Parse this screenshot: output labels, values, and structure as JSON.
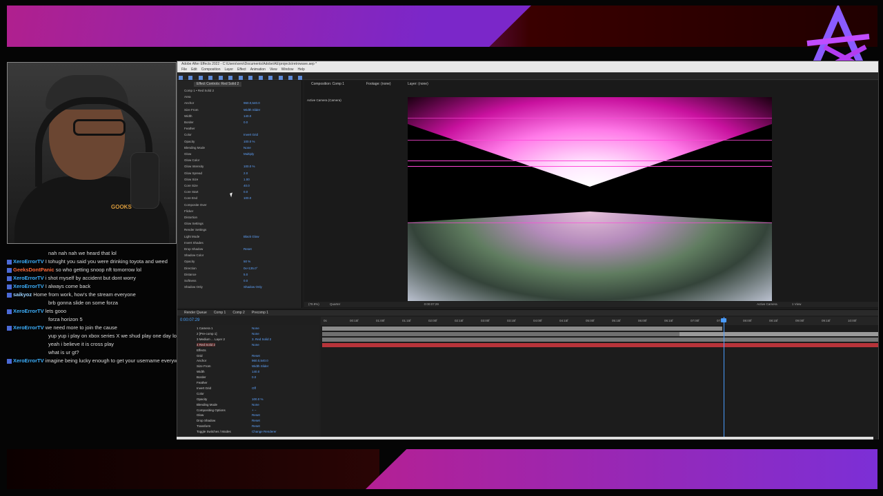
{
  "app": {
    "title": "Adobe After Effects 2022 - C:\\Users\\xero\\Documents\\Adobe\\AE\\projects\\retrowave.aep *",
    "menu": [
      "File",
      "Edit",
      "Composition",
      "Layer",
      "Effect",
      "Animation",
      "View",
      "Window",
      "Help"
    ]
  },
  "effects_panel": {
    "tab": "Effect Controls: Red Solid 2",
    "rows": [
      {
        "label": "Comp 1 • Red Solid 2",
        "value": ""
      },
      {
        "label": "Area",
        "value": ""
      },
      {
        "label": "Anchor",
        "value": "960.0,540.0"
      },
      {
        "label": "Size From",
        "value": "Width Slider"
      },
      {
        "label": "Width",
        "value": "140.0"
      },
      {
        "label": "Border",
        "value": "0.0"
      },
      {
        "label": "Feather",
        "value": ""
      },
      {
        "label": "Color",
        "value": "Invert Grid"
      },
      {
        "label": "Opacity",
        "value": "100.0 %"
      },
      {
        "label": "Blending Mode",
        "value": "None"
      },
      {
        "label": "Glow",
        "value": "Multiply"
      },
      {
        "label": "Glow Color",
        "value": ""
      },
      {
        "label": "Glow Intensity",
        "value": "100.0 %"
      },
      {
        "label": "Glow Spread",
        "value": "2.0"
      },
      {
        "label": "Glow Size",
        "value": "1.00"
      },
      {
        "label": "Core Size",
        "value": "40.0"
      },
      {
        "label": "Core Start",
        "value": "0.0"
      },
      {
        "label": "Core End",
        "value": "100.0"
      },
      {
        "label": "Composite Over",
        "value": ""
      },
      {
        "label": "Flicker",
        "value": ""
      },
      {
        "label": "Distortion",
        "value": ""
      },
      {
        "label": "Glow Settings",
        "value": ""
      },
      {
        "label": "Render Settings",
        "value": ""
      },
      {
        "label": "Light Mode",
        "value": "Black Glow"
      },
      {
        "label": "Invert Shades",
        "value": ""
      },
      {
        "label": "Drop Shadow",
        "value": "Reset"
      },
      {
        "label": "Shadow Color",
        "value": ""
      },
      {
        "label": "Opacity",
        "value": "50 %"
      },
      {
        "label": "Direction",
        "value": "0x+135.0°"
      },
      {
        "label": "Distance",
        "value": "5.0"
      },
      {
        "label": "Softness",
        "value": "0.0"
      },
      {
        "label": "Shadow Only",
        "value": "Shadow Only"
      }
    ]
  },
  "comp_panel": {
    "tabs": [
      "Composition: Comp 1",
      "Footage: (none)",
      "Layer: (none)"
    ],
    "active_camera": "Active Camera (Camera)",
    "footer": [
      "(78.9%)",
      "Quarter",
      "0:00:07:29",
      "Active Camera",
      "1 View"
    ]
  },
  "timeline": {
    "tabs": [
      "Render Queue",
      "Comp 1",
      "Comp 2",
      "Precomp 1"
    ],
    "timecode": "0:00:07:29",
    "ruler": [
      "0s",
      "00:15f",
      "01:00f",
      "01:15f",
      "02:00f",
      "02:15f",
      "03:00f",
      "03:15f",
      "04:00f",
      "04:15f",
      "05:00f",
      "05:15f",
      "06:00f",
      "06:15f",
      "07:00f",
      "07:15f",
      "08:00f",
      "08:15f",
      "09:00f",
      "09:15f",
      "10:00f"
    ],
    "layers": [
      {
        "label": "1  Camera 1",
        "value": "None"
      },
      {
        "label": "2  [Pre-comp 1]",
        "value": "None"
      },
      {
        "label": "3  Medium ... Layer 2",
        "value": "3. Red Solid 2"
      },
      {
        "label": "4  Red Solid 2",
        "value": "None"
      },
      {
        "label": "Effects",
        "value": ""
      },
      {
        "label": "Grid",
        "value": "Reset"
      },
      {
        "label": "Anchor",
        "value": "960.0,540.0"
      },
      {
        "label": "Size From",
        "value": "Width Slider"
      },
      {
        "label": "Width",
        "value": "140.0"
      },
      {
        "label": "Border",
        "value": "0.0"
      },
      {
        "label": "Feather",
        "value": ""
      },
      {
        "label": "Invert Grid",
        "value": "Off"
      },
      {
        "label": "Color",
        "value": ""
      },
      {
        "label": "Opacity",
        "value": "100.0 %"
      },
      {
        "label": "Blending Mode",
        "value": "None"
      },
      {
        "label": "Compositing Options",
        "value": "+ −"
      },
      {
        "label": "Glow",
        "value": "Reset"
      },
      {
        "label": "Drop Shadow",
        "value": "Reset"
      },
      {
        "label": "Transform",
        "value": "Reset"
      },
      {
        "label": "Toggle Switches / Modes",
        "value": "Change Renderer"
      }
    ]
  },
  "chat": [
    {
      "user": "",
      "text": "nah nah nah we heard that lol",
      "cls": "u-anon"
    },
    {
      "user": "XeroErrorTV",
      "text": "I tohught you said you were drinking toyota and weed",
      "cls": "u-xero"
    },
    {
      "user": "GeeksDontPanic",
      "text": "so who getting snoop nft tomorrow lol",
      "cls": "u-geek"
    },
    {
      "user": "XeroErrorTV",
      "text": "i shot myself by accident but dont worry",
      "cls": "u-xero"
    },
    {
      "user": "XeroErrorTV",
      "text": "I always come back",
      "cls": "u-xero"
    },
    {
      "user": "saikyoz",
      "text": "Home from work, how's the stream everyone",
      "cls": "u-saiky"
    },
    {
      "user": "",
      "text": "brb gonna slide on some forza",
      "cls": "u-anon"
    },
    {
      "user": "XeroErrorTV",
      "text": "lets gooo",
      "cls": "u-xero"
    },
    {
      "user": "",
      "text": "forza horizon 5",
      "cls": "u-anon"
    },
    {
      "user": "XeroErrorTV",
      "text": "we need more to join the cause",
      "cls": "u-xero"
    },
    {
      "user": "",
      "text": "yup yup i play on xbox series X we shud play one day lol",
      "cls": "u-anon"
    },
    {
      "user": "",
      "text": "yeah i believe it is cross play",
      "cls": "u-anon"
    },
    {
      "user": "",
      "text": "what is ur gt?",
      "cls": "u-anon"
    },
    {
      "user": "XeroErrorTV",
      "text": "imagine being lucky enough to get your username everywhere",
      "cls": "u-xero"
    }
  ],
  "webcam": {
    "shirt_text": "GOOKS"
  },
  "colors": {
    "accent": "#c8119e",
    "timeline_blue": "#4a9cff",
    "banner_purple": "#7c2fd6"
  }
}
